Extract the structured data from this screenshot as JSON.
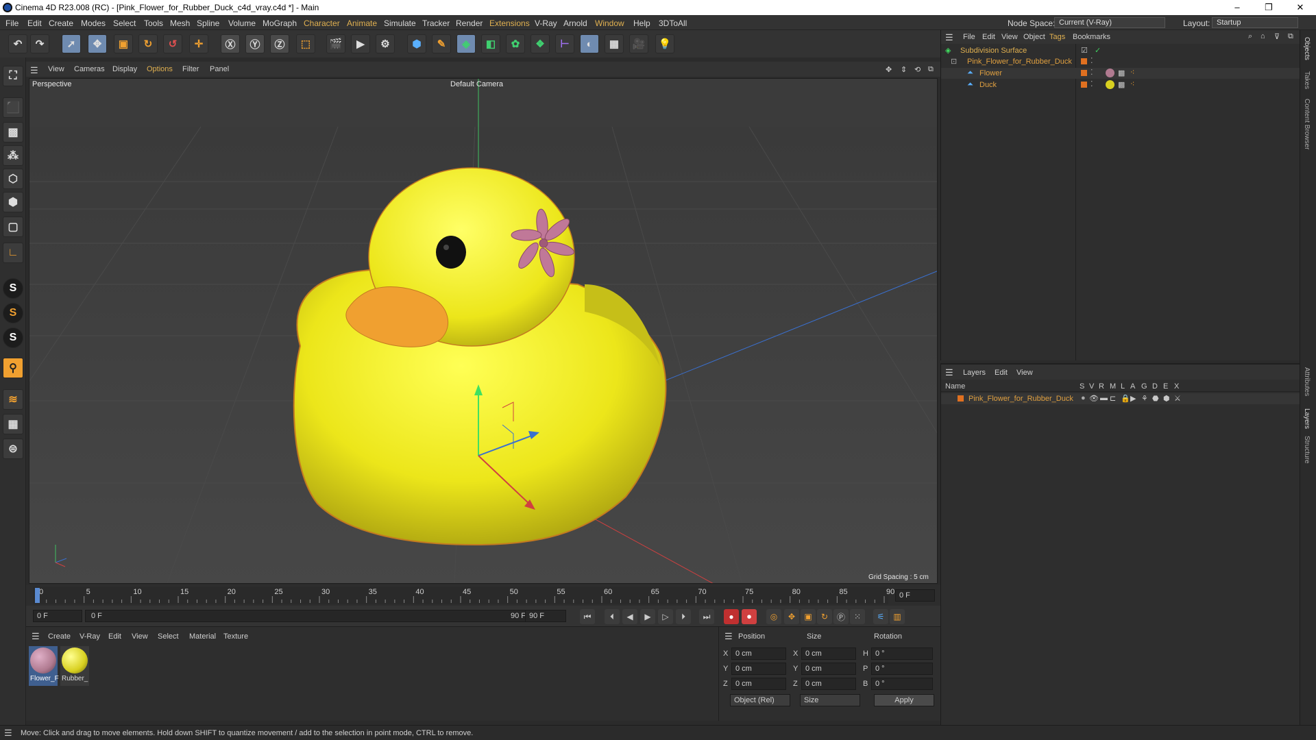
{
  "window": {
    "title": "Cinema 4D R23.008 (RC) - [Pink_Flower_for_Rubber_Duck_c4d_vray.c4d *] - Main",
    "minimize": "–",
    "maximize": "❐",
    "close": "✕"
  },
  "menu": {
    "items": [
      "File",
      "Edit",
      "Create",
      "Modes",
      "Select",
      "Tools",
      "Mesh",
      "Spline",
      "Volume",
      "MoGraph",
      "Character",
      "Animate",
      "Simulate",
      "Tracker",
      "Render",
      "Extensions",
      "V-Ray",
      "Arnold",
      "Window",
      "Help",
      "3DToAll"
    ],
    "node_space_label": "Node Space:",
    "node_space_value": "Current (V-Ray)",
    "layout_label": "Layout:",
    "layout_value": "Startup"
  },
  "viewport": {
    "menu": [
      "View",
      "Cameras",
      "Display",
      "Options",
      "Filter",
      "Panel"
    ],
    "projection": "Perspective",
    "camera": "Default Camera",
    "grid_spacing": "Grid Spacing : 5 cm"
  },
  "timeline": {
    "ticks": [
      "0",
      "5",
      "10",
      "15",
      "20",
      "25",
      "30",
      "35",
      "40",
      "45",
      "50",
      "55",
      "60",
      "65",
      "70",
      "75",
      "80",
      "85",
      "90"
    ],
    "current_frame": "0 F",
    "start_field": "0 F",
    "range_start": "0 F",
    "range_end": "90 F",
    "end_field": "90 F",
    "current_position": 0
  },
  "materials": {
    "menu": [
      "Create",
      "V-Ray",
      "Edit",
      "View",
      "Select",
      "Material",
      "Texture"
    ],
    "items": [
      {
        "label": "Flower_F",
        "color": "#b07a90"
      },
      {
        "label": "Rubber_",
        "color": "#d8d020"
      }
    ]
  },
  "coords": {
    "headers": [
      "Position",
      "Size",
      "Rotation"
    ],
    "rows": [
      {
        "axis": "X",
        "pos": "0 cm",
        "saxis": "X",
        "size": "0 cm",
        "raxis": "H",
        "rot": "0 °"
      },
      {
        "axis": "Y",
        "pos": "0 cm",
        "saxis": "Y",
        "size": "0 cm",
        "raxis": "P",
        "rot": "0 °"
      },
      {
        "axis": "Z",
        "pos": "0 cm",
        "saxis": "Z",
        "size": "0 cm",
        "raxis": "B",
        "rot": "0 °"
      }
    ],
    "mode": "Object (Rel)",
    "size_mode": "Size",
    "apply": "Apply"
  },
  "object_manager": {
    "menu": [
      "File",
      "Edit",
      "View",
      "Object",
      "Tags",
      "Bookmarks"
    ],
    "objects": [
      {
        "name": "Subdivision Surface",
        "indent": 0
      },
      {
        "name": "Pink_Flower_for_Rubber_Duck",
        "indent": 1
      },
      {
        "name": "Flower",
        "indent": 2
      },
      {
        "name": "Duck",
        "indent": 2
      }
    ]
  },
  "layer_manager": {
    "menu": [
      "Layers",
      "Edit",
      "View"
    ],
    "name_header": "Name",
    "flag_headers": [
      "S",
      "V",
      "R",
      "M",
      "L",
      "A",
      "G",
      "D",
      "E",
      "X"
    ],
    "layers": [
      {
        "name": "Pink_Flower_for_Rubber_Duck"
      }
    ]
  },
  "side_tabs": [
    "Objects",
    "Takes",
    "Content Browser",
    "Attributes",
    "Layers",
    "Structure"
  ],
  "status": "Move: Click and drag to move elements. Hold down SHIFT to quantize movement / add to the selection in point mode, CTRL to remove.",
  "colors": {
    "accent": "#e0b050",
    "duck": "#f2ec1a",
    "beak": "#f0a030",
    "flower": "#c07898",
    "layer": "#e07020"
  }
}
